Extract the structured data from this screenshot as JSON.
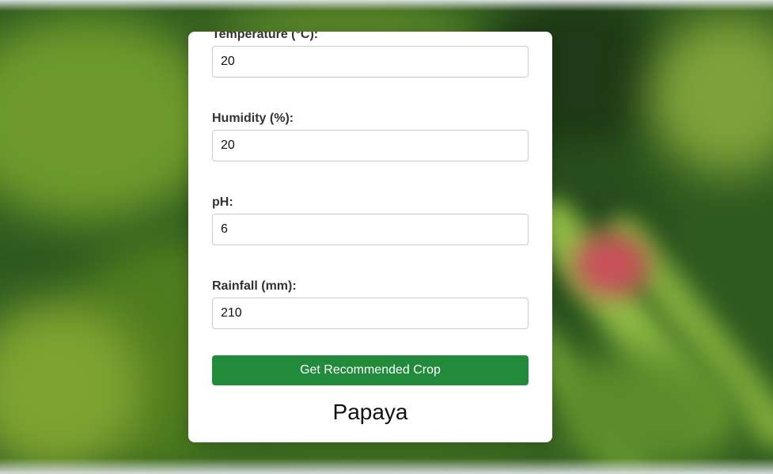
{
  "form": {
    "fields": [
      {
        "label": "Temperature (°C):",
        "value": "20"
      },
      {
        "label": "Humidity (%):",
        "value": "20"
      },
      {
        "label": "pH:",
        "value": "6"
      },
      {
        "label": "Rainfall (mm):",
        "value": "210"
      }
    ],
    "submit_label": "Get Recommended Crop"
  },
  "result": {
    "crop": "Papaya"
  },
  "colors": {
    "button": "#228b3b",
    "card": "#ffffff"
  }
}
